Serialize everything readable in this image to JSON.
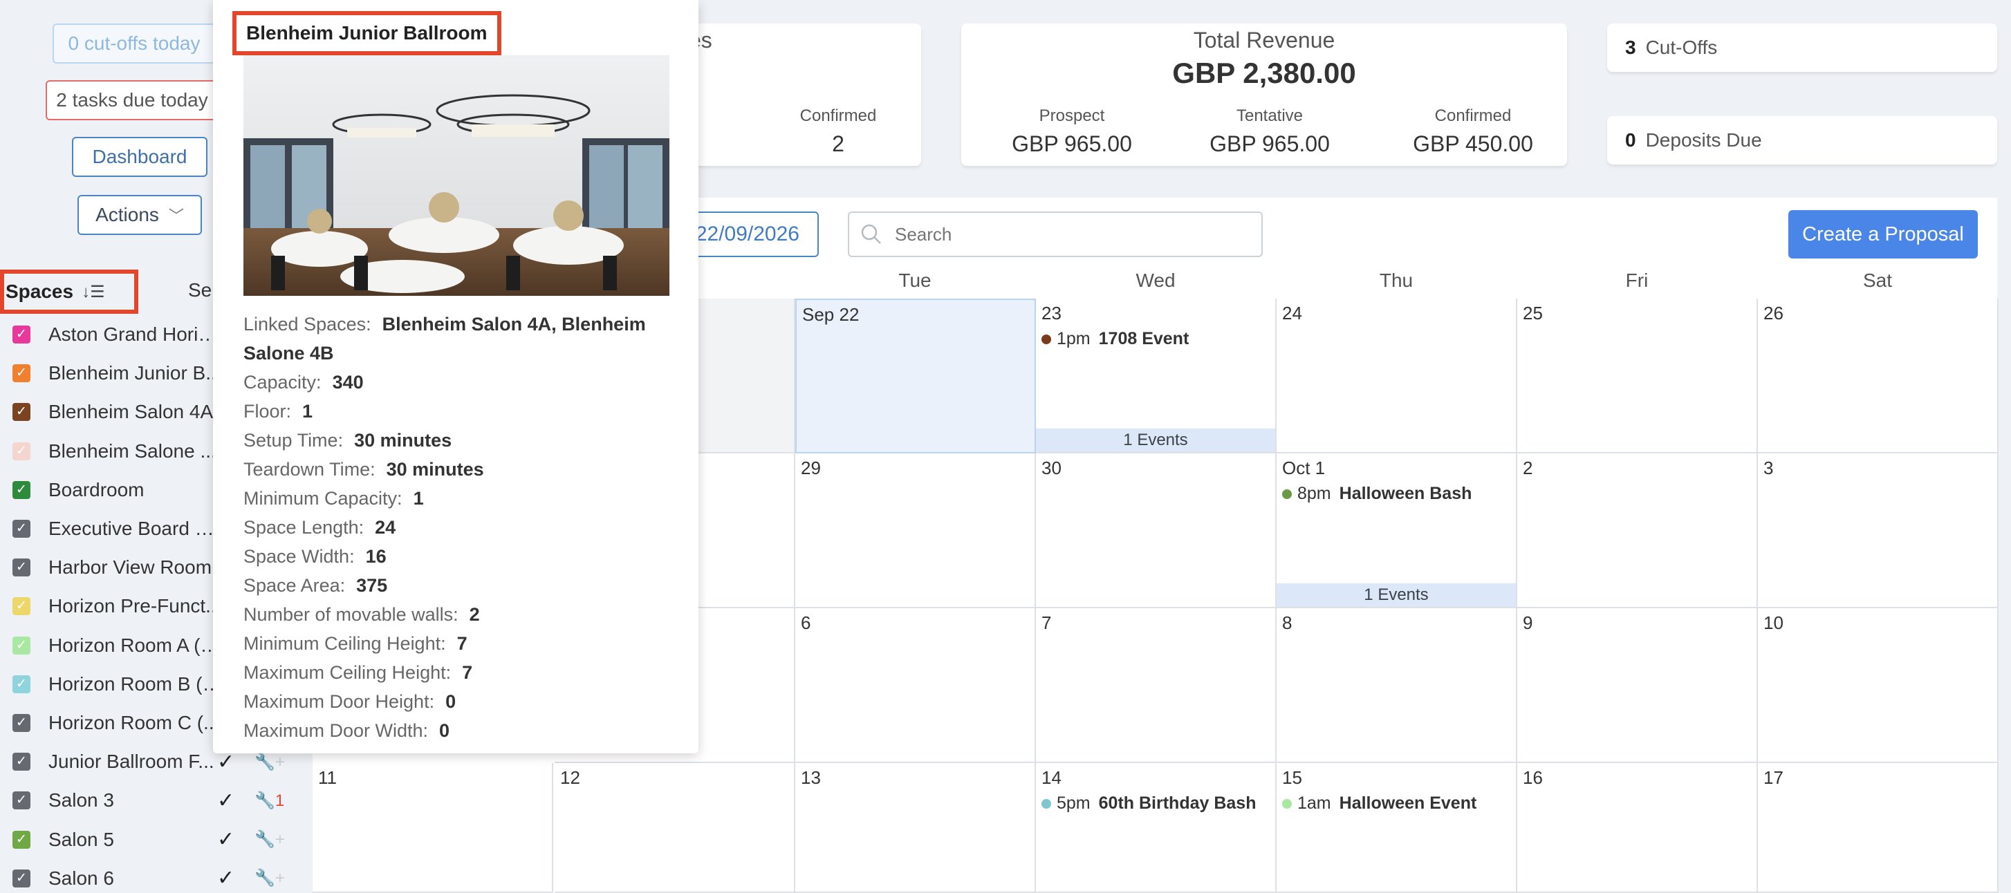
{
  "sidebar": {
    "cutoffs_label": "0 cut-offs today",
    "tasks_label": "2 tasks due today",
    "dashboard_label": "Dashboard",
    "actions_label": "Actions",
    "spaces_label": "Spaces",
    "select_label": "Sel",
    "spaces": [
      {
        "name": "Aston Grand Horiz...",
        "color": "#e6399b",
        "check": "",
        "wrench": "",
        "wrench_active": false
      },
      {
        "name": "Blenheim Junior B...",
        "color": "#f07f2e",
        "check": "",
        "wrench": "",
        "wrench_active": false
      },
      {
        "name": "Blenheim Salon 4A",
        "color": "#7a4420",
        "check": "",
        "wrench": "",
        "wrench_active": false
      },
      {
        "name": "Blenheim Salone ...",
        "color": "#f5d6cf",
        "check": "",
        "wrench": "",
        "wrench_active": false
      },
      {
        "name": "Boardroom",
        "color": "#2e8b3d",
        "check": "",
        "wrench": "",
        "wrench_active": false
      },
      {
        "name": "Executive Board R...",
        "color": "#666a70",
        "check": "",
        "wrench": "",
        "wrench_active": false
      },
      {
        "name": "Harbor View Room",
        "color": "#666a70",
        "check": "",
        "wrench": "",
        "wrench_active": false
      },
      {
        "name": "Horizon Pre-Funct...",
        "color": "#ecd86a",
        "check": "",
        "wrench": "",
        "wrench_active": false
      },
      {
        "name": "Horizon Room A (E...",
        "color": "#a8e8a2",
        "check": "",
        "wrench": "",
        "wrench_active": false
      },
      {
        "name": "Horizon Room B (C...",
        "color": "#8fd3dc",
        "check": "",
        "wrench": "",
        "wrench_active": false
      },
      {
        "name": "Horizon Room C (...",
        "color": "#666a70",
        "check": "",
        "wrench": "",
        "wrench_active": false
      },
      {
        "name": "Junior Ballroom F...",
        "color": "#666a70",
        "check": "✓",
        "wrench": "🔧+",
        "wrench_active": false
      },
      {
        "name": "Salon 3",
        "color": "#666a70",
        "check": "✓",
        "wrench": "🔧1",
        "wrench_active": true
      },
      {
        "name": "Salon 5",
        "color": "#6fa845",
        "check": "✓",
        "wrench": "🔧+",
        "wrench_active": false
      },
      {
        "name": "Salon 6",
        "color": "#666a70",
        "check": "✓",
        "wrench": "🔧+",
        "wrench_active": false
      }
    ]
  },
  "stats": {
    "left_card": {
      "title_partial": "es",
      "confirmed_label": "Confirmed",
      "confirmed_value": "2"
    },
    "revenue": {
      "title": "Total Revenue",
      "total": "GBP 2,380.00",
      "prospect_label": "Prospect",
      "prospect_value": "GBP 965.00",
      "tentative_label": "Tentative",
      "tentative_value": "GBP 965.00",
      "confirmed_label": "Confirmed",
      "confirmed_value": "GBP 450.00"
    },
    "cutoffs_count": "3",
    "cutoffs_label": "Cut-Offs",
    "deposits_count": "0",
    "deposits_label": "Deposits Due"
  },
  "toolbar": {
    "date_partial": "22/09/2026",
    "search_placeholder": "Search",
    "create_label": "Create a Proposal"
  },
  "calendar": {
    "weekdays": [
      "",
      "Tue",
      "Wed",
      "Thu",
      "Fri",
      "Sat"
    ],
    "weeks": [
      [
        {
          "label": "",
          "style": "grey"
        },
        {
          "label": "Sep 22",
          "style": "today"
        },
        {
          "label": "23",
          "event": {
            "time": "1pm",
            "title": "1708 Event",
            "color": "#7a3b1c"
          },
          "more": "1 Events"
        },
        {
          "label": "24"
        },
        {
          "label": "25"
        },
        {
          "label": "26"
        }
      ],
      [
        {
          "label": ""
        },
        {
          "label": "29"
        },
        {
          "label": "30"
        },
        {
          "label": "Oct 1",
          "event": {
            "time": "8pm",
            "title": "Halloween Bash",
            "color": "#6a9a45"
          },
          "more": "1 Events"
        },
        {
          "label": "2"
        },
        {
          "label": "3"
        }
      ],
      [
        {
          "label": ""
        },
        {
          "label": "6"
        },
        {
          "label": "7"
        },
        {
          "label": "8"
        },
        {
          "label": "9"
        },
        {
          "label": "10"
        }
      ],
      [
        {
          "label": "11"
        },
        {
          "label": "12"
        },
        {
          "label": "13"
        },
        {
          "label": "14",
          "event": {
            "time": "5pm",
            "title": "60th Birthday Bash",
            "color": "#7fc6d2"
          }
        },
        {
          "label": "15",
          "event": {
            "time": "1am",
            "title": "Halloween Event",
            "color": "#a8e8a2"
          }
        },
        {
          "label": "16"
        },
        {
          "label": "17"
        }
      ]
    ],
    "extra_col_12": "12"
  },
  "popover": {
    "title": "Blenheim Junior Ballroom",
    "details": [
      {
        "label": "Linked Spaces:",
        "value": "Blenheim Salon 4A, Blenheim Salone 4B"
      },
      {
        "label": "Capacity:",
        "value": "340"
      },
      {
        "label": "Floor:",
        "value": "1"
      },
      {
        "label": "Setup Time:",
        "value": "30 minutes"
      },
      {
        "label": "Teardown Time:",
        "value": "30 minutes"
      },
      {
        "label": "Minimum Capacity:",
        "value": "1"
      },
      {
        "label": "Space Length:",
        "value": "24"
      },
      {
        "label": "Space Width:",
        "value": "16"
      },
      {
        "label": "Space Area:",
        "value": "375"
      },
      {
        "label": "Number of movable walls:",
        "value": "2"
      },
      {
        "label": "Minimum Ceiling Height:",
        "value": "7"
      },
      {
        "label": "Maximum Ceiling Height:",
        "value": "7"
      },
      {
        "label": "Maximum Door Height:",
        "value": "0"
      },
      {
        "label": "Maximum Door Width:",
        "value": "0"
      }
    ]
  }
}
